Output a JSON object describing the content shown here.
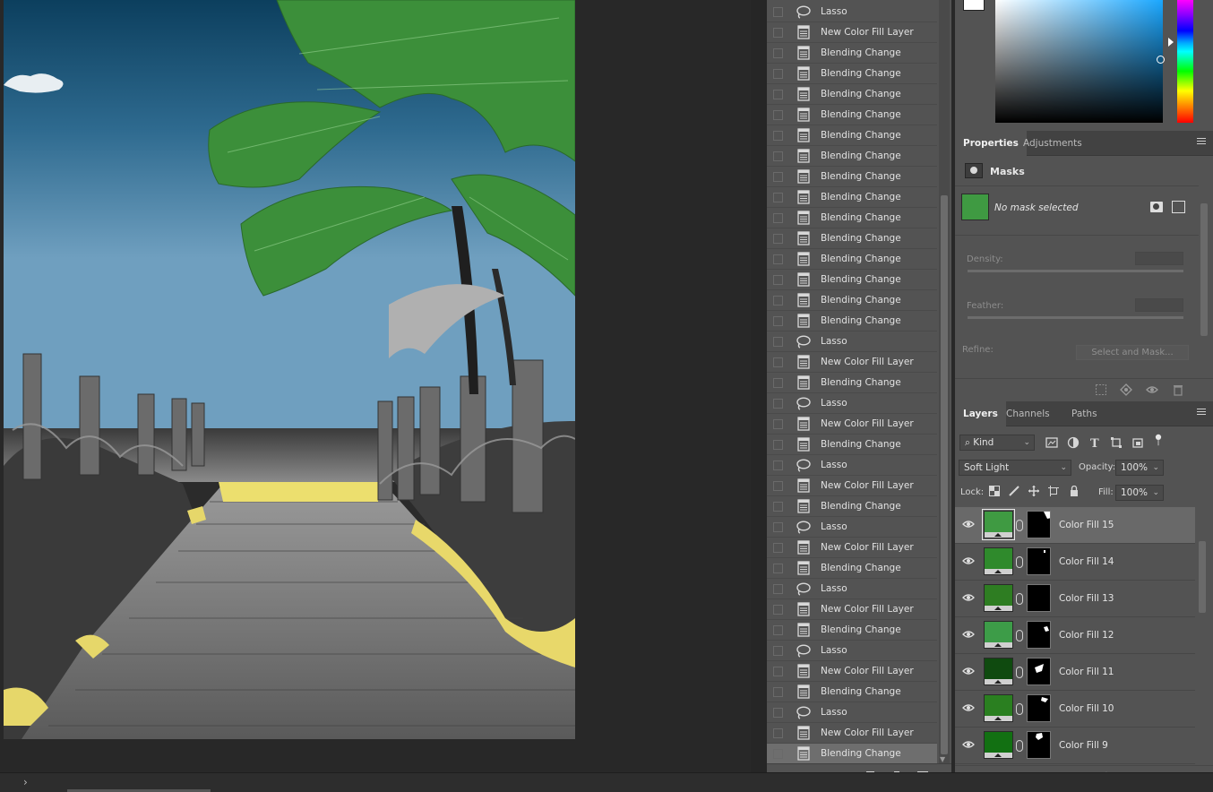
{
  "history": {
    "items": [
      {
        "icon": "lasso-icon",
        "label": "Lasso"
      },
      {
        "icon": "document-icon",
        "label": "New Color Fill Layer"
      },
      {
        "icon": "document-icon",
        "label": "Blending Change"
      },
      {
        "icon": "document-icon",
        "label": "Blending Change"
      },
      {
        "icon": "document-icon",
        "label": "Blending Change"
      },
      {
        "icon": "document-icon",
        "label": "Blending Change"
      },
      {
        "icon": "document-icon",
        "label": "Blending Change"
      },
      {
        "icon": "document-icon",
        "label": "Blending Change"
      },
      {
        "icon": "document-icon",
        "label": "Blending Change"
      },
      {
        "icon": "document-icon",
        "label": "Blending Change"
      },
      {
        "icon": "document-icon",
        "label": "Blending Change"
      },
      {
        "icon": "document-icon",
        "label": "Blending Change"
      },
      {
        "icon": "document-icon",
        "label": "Blending Change"
      },
      {
        "icon": "document-icon",
        "label": "Blending Change"
      },
      {
        "icon": "document-icon",
        "label": "Blending Change"
      },
      {
        "icon": "document-icon",
        "label": "Blending Change"
      },
      {
        "icon": "lasso-icon",
        "label": "Lasso"
      },
      {
        "icon": "document-icon",
        "label": "New Color Fill Layer"
      },
      {
        "icon": "document-icon",
        "label": "Blending Change"
      },
      {
        "icon": "lasso-icon",
        "label": "Lasso"
      },
      {
        "icon": "document-icon",
        "label": "New Color Fill Layer"
      },
      {
        "icon": "document-icon",
        "label": "Blending Change"
      },
      {
        "icon": "lasso-icon",
        "label": "Lasso"
      },
      {
        "icon": "document-icon",
        "label": "New Color Fill Layer"
      },
      {
        "icon": "document-icon",
        "label": "Blending Change"
      },
      {
        "icon": "lasso-icon",
        "label": "Lasso"
      },
      {
        "icon": "document-icon",
        "label": "New Color Fill Layer"
      },
      {
        "icon": "document-icon",
        "label": "Blending Change"
      },
      {
        "icon": "lasso-icon",
        "label": "Lasso"
      },
      {
        "icon": "document-icon",
        "label": "New Color Fill Layer"
      },
      {
        "icon": "document-icon",
        "label": "Blending Change"
      },
      {
        "icon": "lasso-icon",
        "label": "Lasso"
      },
      {
        "icon": "document-icon",
        "label": "New Color Fill Layer"
      },
      {
        "icon": "document-icon",
        "label": "Blending Change"
      },
      {
        "icon": "lasso-icon",
        "label": "Lasso"
      },
      {
        "icon": "document-icon",
        "label": "New Color Fill Layer"
      },
      {
        "icon": "document-icon",
        "label": "Blending Change"
      }
    ],
    "active_index": 36
  },
  "properties": {
    "tabs": [
      "Properties",
      "Adjustments"
    ],
    "active_tab": "Properties",
    "section_title": "Masks",
    "mask_status": "No mask selected",
    "density_label": "Density:",
    "feather_label": "Feather:",
    "refine_label": "Refine:",
    "select_and_mask_label": "Select and Mask..."
  },
  "layers": {
    "tabs": [
      "Layers",
      "Channels",
      "Paths"
    ],
    "active_tab": "Layers",
    "filter_kind": "Kind",
    "blend_mode": "Soft Light",
    "opacity_label": "Opacity:",
    "opacity_value": "100%",
    "lock_label": "Lock:",
    "fill_label": "Fill:",
    "fill_value": "100%",
    "items": [
      {
        "name": "Color Fill 15",
        "color": "#3f9a42",
        "selected": true
      },
      {
        "name": "Color Fill 14",
        "color": "#2f8a2c",
        "selected": false
      },
      {
        "name": "Color Fill 13",
        "color": "#2e7d22",
        "selected": false
      },
      {
        "name": "Color Fill 12",
        "color": "#3d9c48",
        "selected": false
      },
      {
        "name": "Color Fill 11",
        "color": "#0f4a0f",
        "selected": false
      },
      {
        "name": "Color Fill 10",
        "color": "#2a7f20",
        "selected": false
      },
      {
        "name": "Color Fill 9",
        "color": "#127012",
        "selected": false
      }
    ]
  },
  "colors": {
    "panel_bg": "#535353",
    "canvas_bg": "#282828",
    "active_row": "#6e6e6e"
  }
}
